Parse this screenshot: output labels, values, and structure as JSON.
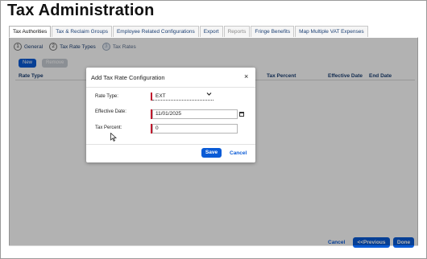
{
  "page": {
    "title": "Tax Administration"
  },
  "tabs": [
    {
      "label": "Tax Authorities"
    },
    {
      "label": "Tax & Reclaim Groups"
    },
    {
      "label": "Employee Related Configurations"
    },
    {
      "label": "Export"
    },
    {
      "label": "Reports"
    },
    {
      "label": "Fringe Benefits"
    },
    {
      "label": "Map Multiple VAT Expenses"
    }
  ],
  "steps": [
    {
      "num": "1",
      "label": "General"
    },
    {
      "num": "2",
      "label": "Tax Rate Types"
    },
    {
      "num": "3",
      "label": "Tax Rates"
    }
  ],
  "toolbar": {
    "new_label": "New",
    "remove_label": "Remove"
  },
  "table": {
    "columns": [
      "Rate Type",
      "Tax Percent",
      "Effective Date",
      "End Date"
    ]
  },
  "footer": {
    "cancel_label": "Cancel",
    "previous_label": "<<Previous",
    "done_label": "Done"
  },
  "modal": {
    "title": "Add Tax Rate Configuration",
    "close_symbol": "×",
    "rate_type_label": "Rate Type:",
    "rate_type_value": "EXT",
    "effective_date_label": "Effective Date:",
    "effective_date_value": "11/01/2025",
    "tax_percent_label": "Tax Percent:",
    "tax_percent_value": "0",
    "save_label": "Save",
    "cancel_label": "Cancel"
  },
  "colors": {
    "accent": "#0a5bd6",
    "required": "#c0182d"
  }
}
